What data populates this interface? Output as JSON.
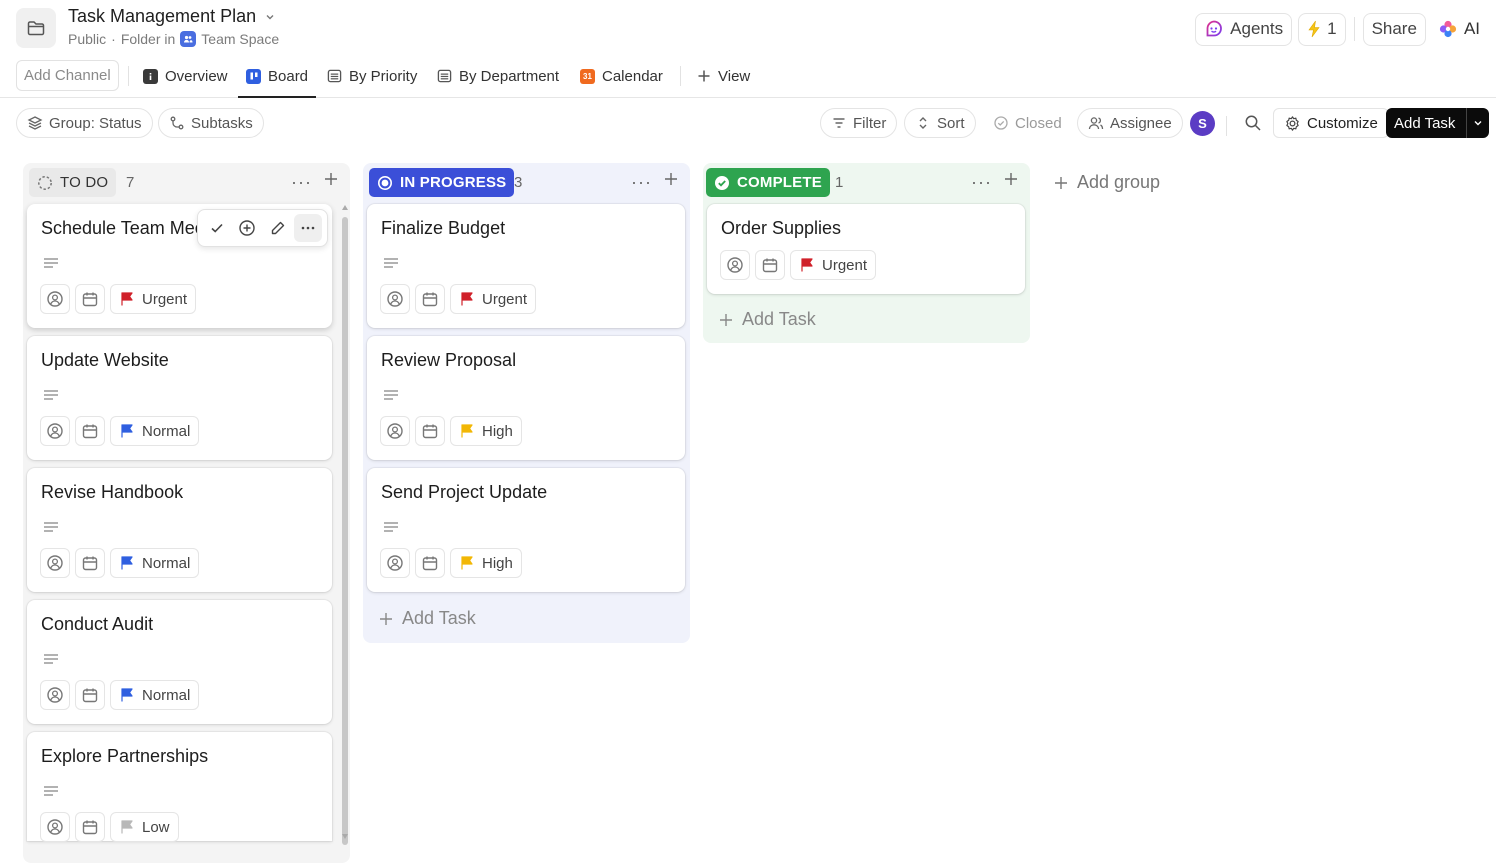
{
  "header": {
    "title": "Task Management Plan",
    "visibility": "Public",
    "folder_in": "Folder in",
    "space": "Team Space",
    "agents_label": "Agents",
    "lightning_count": "1",
    "share_label": "Share",
    "ai_label": "AI"
  },
  "views": {
    "add_channel": "Add Channel",
    "tabs": [
      {
        "label": "Overview"
      },
      {
        "label": "Board"
      },
      {
        "label": "By Priority"
      },
      {
        "label": "By Department"
      },
      {
        "label": "Calendar",
        "icon_text": "31"
      },
      {
        "label": "View"
      }
    ]
  },
  "toolbar": {
    "group_status": "Group: Status",
    "subtasks": "Subtasks",
    "filter": "Filter",
    "sort": "Sort",
    "closed": "Closed",
    "assignee": "Assignee",
    "avatar_initial": "S",
    "customize": "Customize",
    "add_task": "Add Task"
  },
  "board": {
    "columns": [
      {
        "status": "TO DO",
        "count": "7",
        "color": "#888888",
        "cards": [
          {
            "title": "Schedule Team Meeting",
            "priority": "Urgent",
            "flag_color": "#d0212a"
          },
          {
            "title": "Update Website",
            "priority": "Normal",
            "flag_color": "#2f5fe0"
          },
          {
            "title": "Revise Handbook",
            "priority": "Normal",
            "flag_color": "#2f5fe0"
          },
          {
            "title": "Conduct Audit",
            "priority": "Normal",
            "flag_color": "#2f5fe0"
          },
          {
            "title": "Explore Partnerships",
            "priority": "Low",
            "flag_color": "#b8b8b8"
          }
        ]
      },
      {
        "status": "IN PROGRESS",
        "count": "3",
        "color": "#3b4fd8",
        "cards": [
          {
            "title": "Finalize Budget",
            "priority": "Urgent",
            "flag_color": "#d0212a"
          },
          {
            "title": "Review Proposal",
            "priority": "High",
            "flag_color": "#f2b705"
          },
          {
            "title": "Send Project Update",
            "priority": "High",
            "flag_color": "#f2b705"
          }
        ],
        "add_task": "Add Task"
      },
      {
        "status": "COMPLETE",
        "count": "1",
        "color": "#2ea44f",
        "cards": [
          {
            "title": "Order Supplies",
            "priority": "Urgent",
            "flag_color": "#d0212a"
          }
        ],
        "add_task": "Add Task"
      }
    ],
    "add_group": "Add group"
  }
}
